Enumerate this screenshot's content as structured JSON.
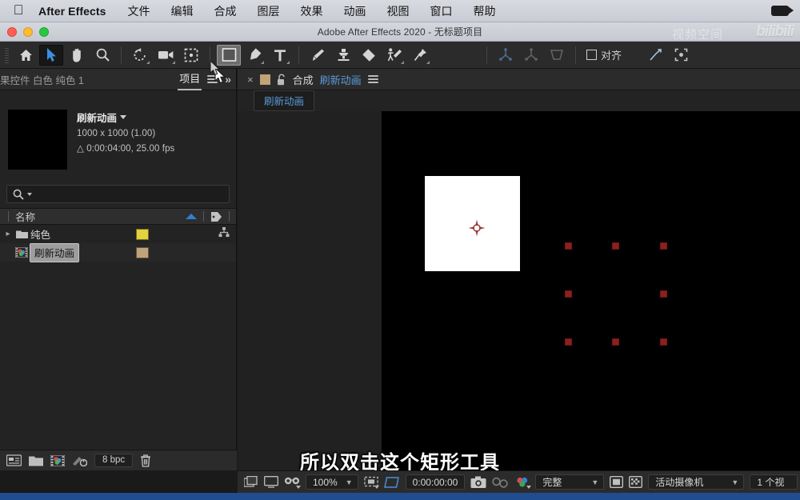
{
  "menubar": {
    "apple_icon": "apple-logo-icon",
    "app_name": "After Effects",
    "items": [
      "文件",
      "编辑",
      "合成",
      "图层",
      "效果",
      "动画",
      "视图",
      "窗口",
      "帮助"
    ],
    "right_icon": "screen-record-camera-icon"
  },
  "titlebar": {
    "title": "Adobe After Effects 2020 - 无标题项目",
    "watermark": "bilibili",
    "watermark_cn": "视频空间"
  },
  "toolbar": {
    "tools": [
      {
        "name": "home-icon",
        "state": "normal"
      },
      {
        "name": "selection-tool-icon",
        "state": "active"
      },
      {
        "name": "hand-tool-icon",
        "state": "normal"
      },
      {
        "name": "zoom-tool-icon",
        "state": "normal"
      },
      {
        "name": "rotation-tool-icon",
        "state": "normal"
      },
      {
        "name": "camera-tool-icon",
        "state": "normal"
      },
      {
        "name": "anchor-point-tool-icon",
        "state": "normal"
      },
      {
        "name": "rectangle-tool-icon",
        "state": "hot"
      },
      {
        "name": "pen-tool-icon",
        "state": "normal"
      },
      {
        "name": "text-tool-icon",
        "state": "normal"
      },
      {
        "name": "brush-tool-icon",
        "state": "normal"
      },
      {
        "name": "clone-stamp-tool-icon",
        "state": "normal"
      },
      {
        "name": "eraser-tool-icon",
        "state": "normal"
      },
      {
        "name": "roto-brush-tool-icon",
        "state": "normal"
      },
      {
        "name": "puppet-pin-tool-icon",
        "state": "normal"
      }
    ],
    "align_label": "对齐",
    "snapping_icons": [
      "axis-3d-icon",
      "axis-local-icon",
      "axis-view-icon",
      "snap-icon",
      "mask-transform-icon"
    ]
  },
  "project_panel": {
    "inactive_tab": "果控件 白色 纯色 1",
    "active_tab": "项目",
    "menu_icon": "panel-menu-icon",
    "overflow_icon": "chevron-double-right-icon",
    "selected_item": {
      "name": "刷新动画",
      "dimensions": "1000 x 1000 (1.00)",
      "duration": "0:00:04:00, 25.00 fps",
      "duration_prefix": "△"
    },
    "search_placeholder": "",
    "search_icon": "search-icon",
    "column_name": "名称",
    "sort_icon": "sort-ascending-icon",
    "tag_icon": "label-tag-icon",
    "rows": [
      {
        "name": "纯色",
        "icon": "folder-icon",
        "label_color": "#e3d23c",
        "expandable": true,
        "selected": false,
        "has_share": true
      },
      {
        "name": "刷新动画",
        "icon": "composition-icon",
        "label_color": "#c2a278",
        "expandable": false,
        "selected": true,
        "has_share": false
      }
    ],
    "footer": {
      "icons": [
        "interpret-footage-icon",
        "new-folder-icon",
        "new-composition-icon",
        "project-settings-icon",
        "delete-icon"
      ],
      "bit_depth": "8 bpc"
    }
  },
  "comp_panel": {
    "close_icon": "close-tab-icon",
    "comp_chip_color": "#c2a278",
    "lock_icon": "lock-open-icon",
    "kind_label": "合成",
    "comp_name": "刷新动画",
    "menu_icon": "panel-menu-icon",
    "breadcrumb": "刷新动画"
  },
  "viewer": {
    "layer_name": "白色 纯色 1",
    "selection_handle_color": "#8f2020",
    "anchor_icon": "anchor-point-icon",
    "canvas_bg": "#000000"
  },
  "comp_footer": {
    "icons": [
      "always-preview-icon",
      "main-viewer-icon",
      "3d-glasses-icon",
      "region-of-interest-icon",
      "transparency-grid-icon",
      "snapshot-icon",
      "show-snapshot-icon",
      "channels-icon",
      "toggle-mask-icon",
      "toggle-alpha-icon"
    ],
    "zoom_level": "100%",
    "timecode": "0:00:00:00",
    "resolution": "完整",
    "camera_view": "活动摄像机",
    "view_count": "1 个视"
  },
  "subtitle": "所以双击这个矩形工具",
  "colors": {
    "panel_bg": "#232323",
    "toolbar_bg": "#2b2b2b",
    "accent_blue": "#5b9bd8",
    "sort_blue": "#2f7fd6",
    "bottom_edge": "#1f4d8f"
  }
}
